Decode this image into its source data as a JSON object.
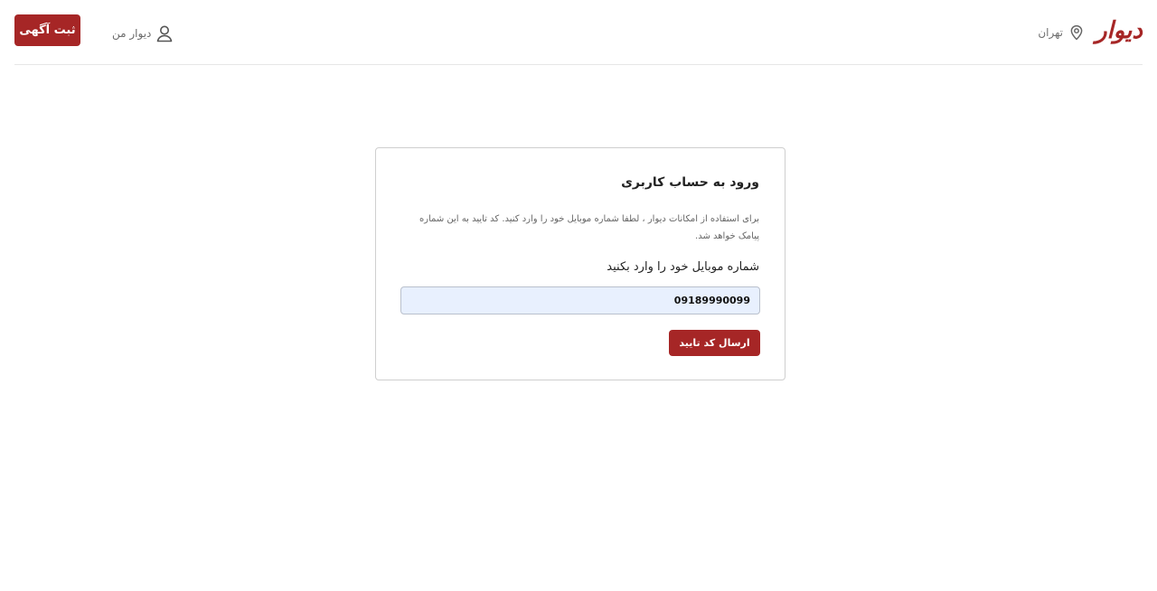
{
  "header": {
    "logo_text": "دیوار",
    "city_label": "تهران",
    "city_icon": "location-pin-icon",
    "my_divar_label": "دیوار من",
    "user_icon": "user-icon",
    "submit_ad_label": "ثبت آگهی"
  },
  "login": {
    "title": "ورود به حساب کاربری",
    "description": "برای استفاده از امکانات دیوار ، لطفا شماره موبایل خود را وارد کنید. کد تایید به این شماره پیامک خواهد شد.",
    "field_label": "شماره موبایل خود را وارد بکنید",
    "phone_value": "09189990099",
    "send_code_label": "ارسال کد تایید"
  },
  "colors": {
    "brand": "#a62626",
    "input_bg": "#e8f0fe",
    "divider": "#e6e6e6"
  }
}
